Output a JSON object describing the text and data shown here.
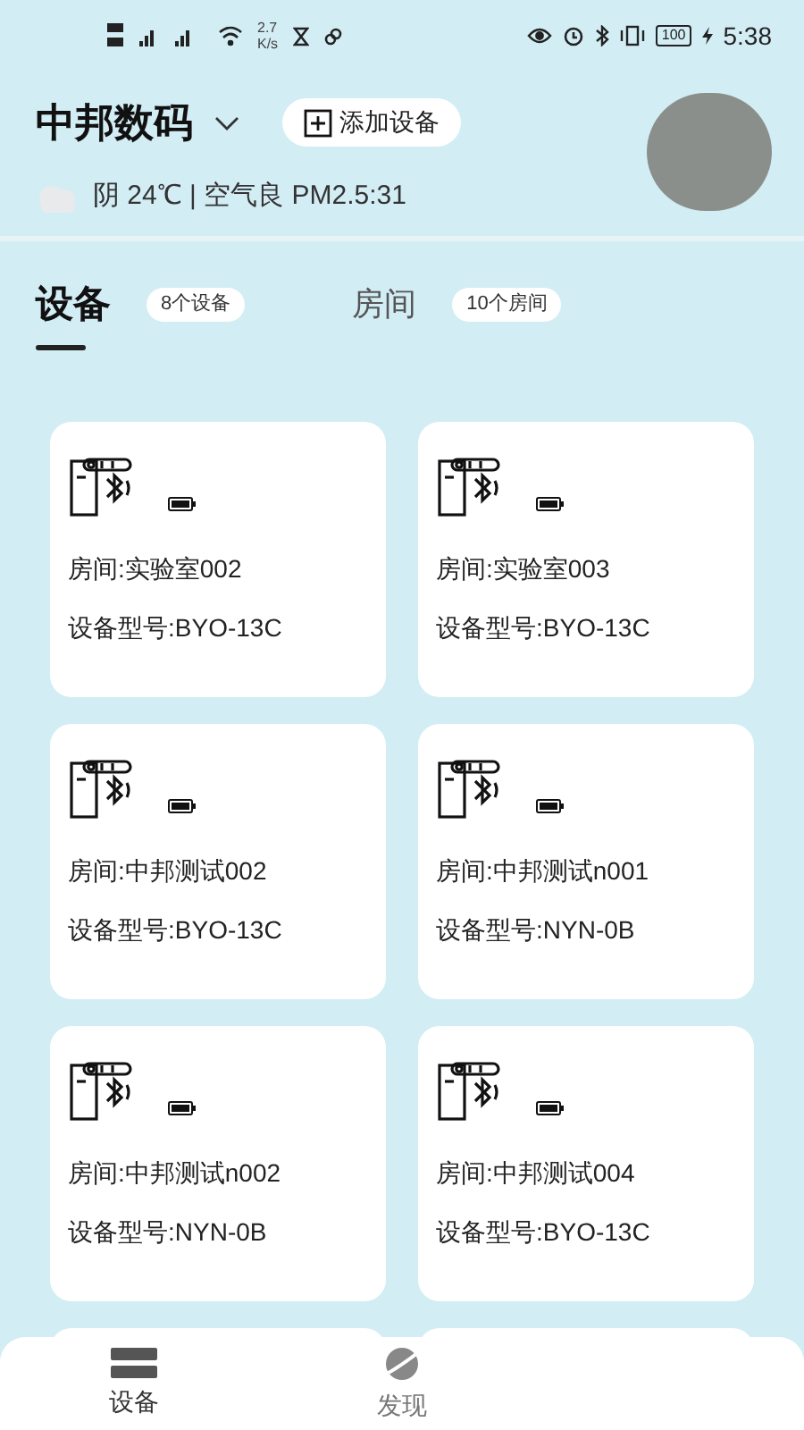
{
  "status_bar": {
    "network_speed": "2.7",
    "speed_unit": "K/s",
    "battery": "100",
    "time": "5:38"
  },
  "header": {
    "title": "中邦数码",
    "add_button": "添加设备",
    "weather": "阴 24℃ | 空气良 PM2.5:31"
  },
  "tabs": [
    {
      "label": "设备",
      "count": "8个设备",
      "selected": true
    },
    {
      "label": "房间",
      "count": "10个房间",
      "selected": false
    }
  ],
  "devices": [
    {
      "room": "房间:实验室002",
      "model": "设备型号:BYO-13C"
    },
    {
      "room": "房间:实验室003",
      "model": "设备型号:BYO-13C"
    },
    {
      "room": "房间:中邦测试002",
      "model": "设备型号:BYO-13C"
    },
    {
      "room": "房间:中邦测试n001",
      "model": "设备型号:NYN-0B"
    },
    {
      "room": "房间:中邦测试n002",
      "model": "设备型号:NYN-0B"
    },
    {
      "room": "房间:中邦测试004",
      "model": "设备型号:BYO-13C"
    }
  ],
  "bottom_nav": [
    {
      "label": "设备",
      "kind": "devices",
      "selected": true
    },
    {
      "label": "发现",
      "kind": "discover",
      "selected": false
    }
  ]
}
